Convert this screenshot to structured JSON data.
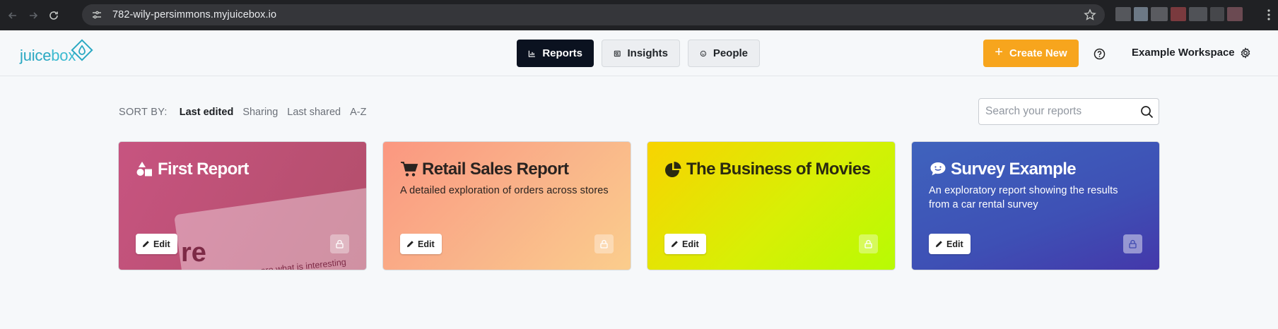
{
  "browser": {
    "url": "782-wily-persimmons.myjuicebox.io"
  },
  "app": {
    "logo_text_1": "juice",
    "logo_text_2": "box",
    "brand_color": "#2aa8c2"
  },
  "nav": {
    "tabs": [
      {
        "label": "Reports",
        "icon": "bar-chart-icon",
        "active": true
      },
      {
        "label": "Insights",
        "icon": "newspaper-icon",
        "active": false
      },
      {
        "label": "People",
        "icon": "smiley-icon",
        "active": false
      }
    ],
    "create_label": "Create New",
    "create_color": "#f7a51d",
    "workspace": "Example Workspace"
  },
  "sort": {
    "label": "SORT BY:",
    "options": [
      "Last edited",
      "Sharing",
      "Last shared",
      "A-Z"
    ],
    "selected": "Last edited"
  },
  "search": {
    "placeholder": "Search your reports"
  },
  "cards": [
    {
      "title": "First Report",
      "icon": "shapes-icon",
      "description": "",
      "edit_label": "Edit",
      "preview_big": "re",
      "preview_small": "...ore what is interesting"
    },
    {
      "title": "Retail Sales Report",
      "icon": "shopping-cart-icon",
      "description": "A detailed exploration of orders across stores",
      "edit_label": "Edit"
    },
    {
      "title": "The Business of Movies",
      "icon": "pie-chart-icon",
      "description": "",
      "edit_label": "Edit"
    },
    {
      "title": "Survey Example",
      "icon": "speech-bubble-icon",
      "description": "An exploratory report showing the results from a car rental survey",
      "edit_label": "Edit"
    }
  ]
}
